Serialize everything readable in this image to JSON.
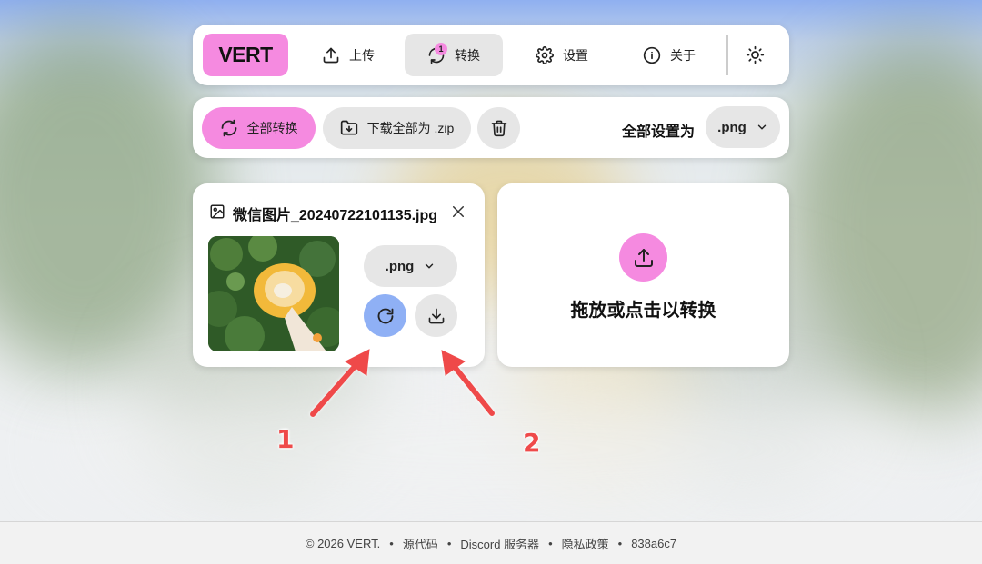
{
  "nav": {
    "logo": "VERT",
    "items": [
      {
        "label": "上传",
        "icon": "upload-icon"
      },
      {
        "label": "转换",
        "icon": "refresh-icon",
        "badge": "1",
        "active": true
      },
      {
        "label": "设置",
        "icon": "gear-icon"
      },
      {
        "label": "关于",
        "icon": "info-icon"
      }
    ],
    "theme_icon": "sun-icon"
  },
  "toolbar": {
    "convert_all": "全部转换",
    "download_zip": "下载全部为 .zip",
    "set_all_label": "全部设置为",
    "format": ".png"
  },
  "file": {
    "name": "微信图片_20240722101135.jpg",
    "format": ".png"
  },
  "dropzone": {
    "label": "拖放或点击以转换"
  },
  "annotations": {
    "one": "1",
    "two": "2"
  },
  "footer": {
    "copyright": "© 2026 VERT.",
    "source": "源代码",
    "discord": "Discord 服务器",
    "privacy": "隐私政策",
    "commit": "838a6c7"
  },
  "colors": {
    "accent_pink": "#f58ae0",
    "convert_blue": "#8fb0f5",
    "arrow_red": "#ef4a4a"
  }
}
